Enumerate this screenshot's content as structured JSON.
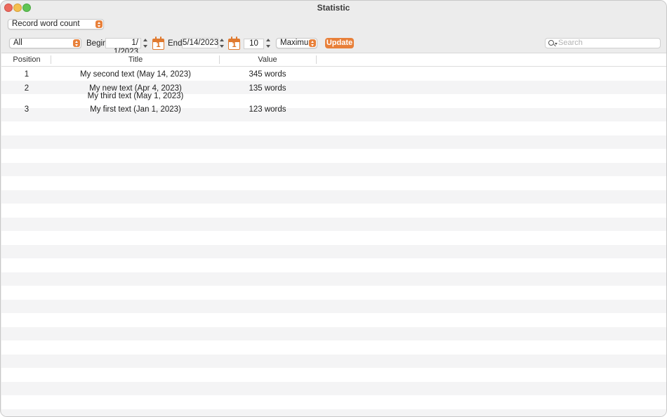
{
  "window": {
    "title": "Statistic"
  },
  "toolbar": {
    "statistic_type": "Record word count",
    "filter": "All",
    "begin_label": "Begin:",
    "begin_date": "1/  1/2023",
    "end_label": "End:",
    "end_date": "5/14/2023",
    "begin_calendar_day": "1",
    "end_calendar_day": "1",
    "count": "10",
    "mode": "Maximum",
    "update_label": "Update",
    "search_placeholder": "Search"
  },
  "table": {
    "columns": [
      "Position",
      "Title",
      "Value"
    ],
    "rows": [
      {
        "position": "1",
        "title_lines": [
          "My second text (May 14, 2023)"
        ],
        "value": "345 words"
      },
      {
        "position": "2",
        "title_lines": [
          "My new text (Apr 4, 2023)",
          "My third text (May 1, 2023)"
        ],
        "value": "135 words"
      },
      {
        "position": "3",
        "title_lines": [
          "My first text (Jan 1, 2023)"
        ],
        "value": "123 words"
      }
    ]
  },
  "colors": {
    "accent": "#e8803a",
    "stripe": "#f4f4f5"
  }
}
